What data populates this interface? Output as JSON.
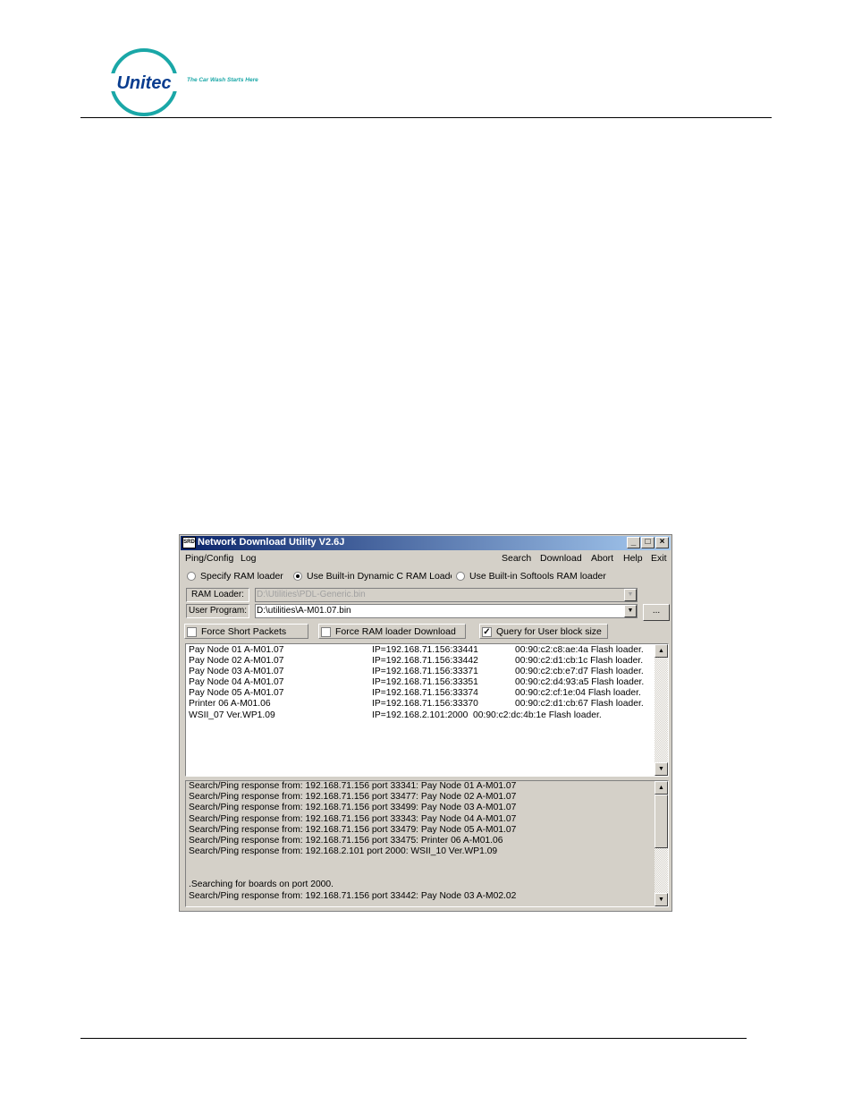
{
  "brand": {
    "name": "Unitec",
    "tagline": "The Car Wash Starts Here",
    "color": "#1aa7a7"
  },
  "window": {
    "title": "Network Download Utility V2.6J",
    "icon_label": "SRD",
    "controls": [
      "_",
      "□",
      "×"
    ]
  },
  "menu": {
    "left": [
      "Ping/Config",
      "Log"
    ],
    "right": [
      "Search",
      "Download",
      "Abort",
      "Help",
      "Exit"
    ]
  },
  "radios": [
    {
      "label": "Specify RAM loader",
      "selected": false
    },
    {
      "label": "Use Built-in Dynamic C RAM Loader",
      "selected": true
    },
    {
      "label": "Use Built-in Softools RAM loader",
      "selected": false
    }
  ],
  "ram_loader": {
    "label": "RAM Loader:",
    "value": "D:\\Utilities\\PDL-Generic.bin"
  },
  "user_program": {
    "label": "User Program:",
    "value": "D:\\utilities\\A-M01.07.bin"
  },
  "browse_label": "...",
  "checkboxes": [
    {
      "label": "Force Short Packets",
      "checked": false
    },
    {
      "label": "Force RAM loader Download",
      "checked": false
    },
    {
      "label": "Query for User block size",
      "checked": true
    }
  ],
  "boards": [
    {
      "name": "Pay Node 01  A-M01.07",
      "ip": "IP=192.168.71.156:33441",
      "mac": "00:90:c2:c8:ae:4a Flash loader."
    },
    {
      "name": "Pay Node 02  A-M01.07",
      "ip": "IP=192.168.71.156:33442",
      "mac": "00:90:c2:d1:cb:1c Flash loader."
    },
    {
      "name": "Pay Node 03  A-M01.07",
      "ip": "IP=192.168.71.156:33371",
      "mac": "00:90:c2:cb:e7:d7 Flash loader."
    },
    {
      "name": "Pay Node 04  A-M01.07",
      "ip": "IP=192.168.71.156:33351",
      "mac": "00:90:c2:d4:93:a5 Flash loader."
    },
    {
      "name": "Pay Node 05  A-M01.07",
      "ip": "IP=192.168.71.156:33374",
      "mac": "00:90:c2:cf:1e:04 Flash loader."
    },
    {
      "name": "Printer 06  A-M01.06",
      "ip": "IP=192.168.71.156:33370",
      "mac": "00:90:c2:d1:cb:67 Flash loader."
    },
    {
      "name": "WSII_07 Ver.WP1.09",
      "ip": "IP=192.168.2.101:2000",
      "mac": "00:90:c2:dc:4b:1e Flash loader."
    }
  ],
  "log": [
    "Search/Ping response from: 192.168.71.156 port 33341: Pay Node 01  A-M01.07",
    "Search/Ping response from: 192.168.71.156 port 33477: Pay Node 02  A-M01.07",
    "Search/Ping response from: 192.168.71.156 port 33499: Pay Node 03  A-M01.07",
    "Search/Ping response from: 192.168.71.156 port 33343: Pay Node 04  A-M01.07",
    "Search/Ping response from: 192.168.71.156 port 33479: Pay Node 05  A-M01.07",
    "Search/Ping response from: 192.168.71.156 port 33475: Printer 06  A-M01.06",
    "Search/Ping response from: 192.168.2.101 port 2000:  WSII_10 Ver.WP1.09",
    "",
    "",
    ".Searching for boards on port 2000.",
    "Search/Ping response from: 192.168.71.156 port 33442: Pay Node 03  A-M02.02"
  ],
  "scroll_arrows": {
    "up": "▲",
    "down": "▼"
  }
}
